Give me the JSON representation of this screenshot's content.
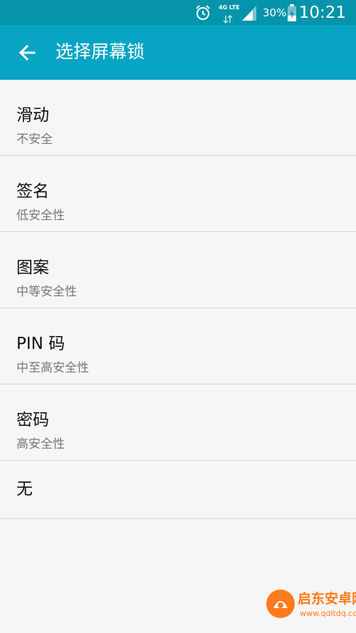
{
  "status_bar": {
    "time": "10:21",
    "battery_percent": "30%",
    "network": "4G LTE",
    "icons": [
      "alarm-icon",
      "network-arrows-icon",
      "signal-icon",
      "battery-charging-icon"
    ]
  },
  "app_bar": {
    "title": "选择屏幕锁",
    "back_icon": "arrow-back-icon",
    "color": "#07a5c3"
  },
  "options": [
    {
      "title": "滑动",
      "subtitle": "不安全"
    },
    {
      "title": "签名",
      "subtitle": "低安全性"
    },
    {
      "title": "图案",
      "subtitle": "中等安全性"
    },
    {
      "title": "PIN 码",
      "subtitle": "中至高安全性"
    },
    {
      "title": "密码",
      "subtitle": "高安全性"
    },
    {
      "title": "无",
      "subtitle": ""
    }
  ],
  "watermark": {
    "text": "启东安卓网",
    "url": "www.qdltdq.com"
  }
}
